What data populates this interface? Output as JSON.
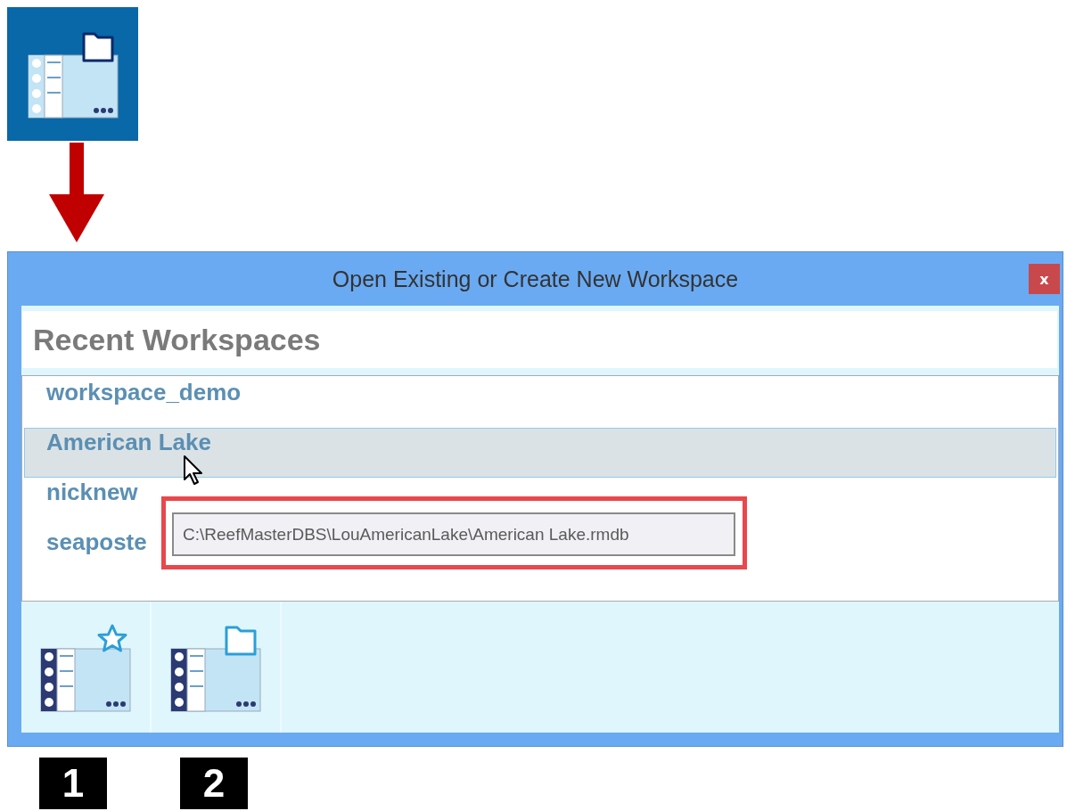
{
  "window": {
    "title": "Open Existing or Create New Workspace",
    "close": "x"
  },
  "section_heading": "Recent Workspaces",
  "workspaces": [
    {
      "name": "workspace_demo",
      "selected": false
    },
    {
      "name": "American Lake",
      "selected": true
    },
    {
      "name": "nicknew",
      "selected": false
    },
    {
      "name": "seaposte",
      "selected": false
    }
  ],
  "tooltip": {
    "text": "C:\\ReefMasterDBS\\LouAmericanLake\\American Lake.rmdb"
  },
  "toolbar_buttons": [
    {
      "kind": "new"
    },
    {
      "kind": "open"
    }
  ],
  "callouts": [
    "1",
    "2"
  ]
}
